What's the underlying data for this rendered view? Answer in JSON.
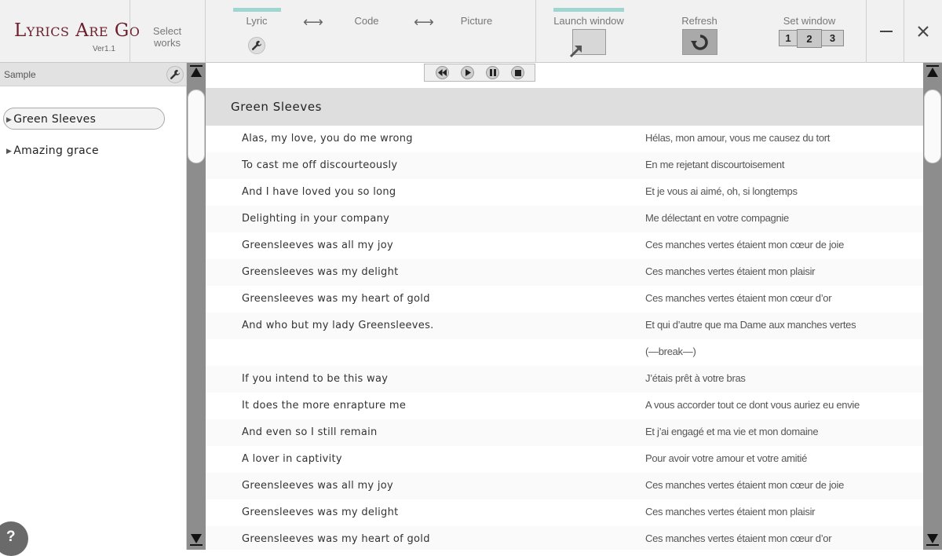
{
  "app": {
    "title": "Lyrics Are Go",
    "version": "Ver1.1"
  },
  "toolbar": {
    "select_works_line1": "Select",
    "select_works_line2": "works",
    "modes": [
      {
        "label": "Lyric",
        "active": true
      },
      {
        "label": "Code",
        "active": false
      },
      {
        "label": "Picture",
        "active": false
      }
    ],
    "mode_arrow": "⟷",
    "launch_window_label": "Launch window",
    "refresh_label": "Refresh",
    "set_window_label": "Set window",
    "set_window_options": [
      "1",
      "2",
      "3"
    ],
    "set_window_selected": "2",
    "accent_color": "#9fd6d2"
  },
  "sidebar": {
    "title": "Sample",
    "works": [
      {
        "label": "Green Sleeves",
        "selected": true
      },
      {
        "label": "Amazing grace",
        "selected": false
      }
    ]
  },
  "player": {
    "buttons": [
      "rewind",
      "play",
      "pause",
      "stop"
    ]
  },
  "song": {
    "title": "Green Sleeves",
    "lines": [
      {
        "original": "Alas, my love, you do me wrong",
        "translation": "Hélas, mon amour, vous me causez du tort"
      },
      {
        "original": "To cast me off discourteously",
        "translation": "En me rejetant discourtoisement"
      },
      {
        "original": "And I have loved you so long",
        "translation": "Et je vous ai aimé, oh, si longtemps"
      },
      {
        "original": "Delighting in your company",
        "translation": "Me délectant en votre compagnie"
      },
      {
        "original": "Greensleeves was all my joy",
        "translation": "Ces manches vertes étaient mon cœur de joie"
      },
      {
        "original": "Greensleeves was my delight",
        "translation": "Ces manches vertes étaient mon plaisir"
      },
      {
        "original": "Greensleeves was my heart of gold",
        "translation": "Ces manches vertes étaient mon cœur d’or"
      },
      {
        "original": "And who but my lady Greensleeves.",
        "translation": "Et qui d’autre que ma Dame aux manches vertes"
      },
      {
        "original": "",
        "translation": "(―break―)"
      },
      {
        "original": "If you intend to be this way",
        "translation": "J’étais prêt à votre bras"
      },
      {
        "original": "It does the more enrapture me",
        "translation": "A vous accorder tout ce dont vous auriez eu envie"
      },
      {
        "original": "And even so I still remain",
        "translation": "Et j’ai engagé et ma vie et mon domaine"
      },
      {
        "original": "A lover in captivity",
        "translation": "Pour avoir votre amour et votre amitié"
      },
      {
        "original": "Greensleeves was all my joy",
        "translation": "Ces manches vertes étaient mon cœur de joie"
      },
      {
        "original": "Greensleeves was my delight",
        "translation": "Ces manches vertes étaient mon plaisir"
      },
      {
        "original": "Greensleeves was my heart of gold",
        "translation": "Ces manches vertes étaient mon cœur d’or"
      }
    ]
  },
  "help_label": "?"
}
